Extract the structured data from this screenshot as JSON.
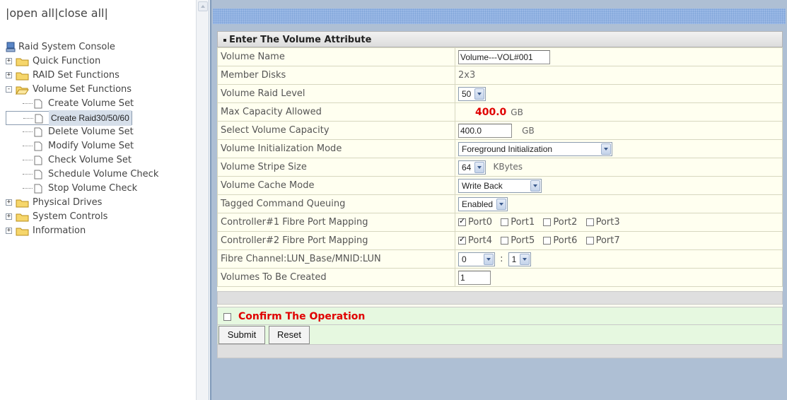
{
  "left": {
    "open_all": "open all",
    "close_all": "close all",
    "root_label": "Raid System Console",
    "items": [
      {
        "label": "Quick Function",
        "expander": "+"
      },
      {
        "label": "RAID Set Functions",
        "expander": "+"
      },
      {
        "label": "Volume Set Functions",
        "expander": "-"
      }
    ],
    "sub_items": [
      {
        "label": "Create Volume Set"
      },
      {
        "label": "Create Raid30/50/60"
      },
      {
        "label": "Delete Volume Set"
      },
      {
        "label": "Modify Volume Set"
      },
      {
        "label": "Check Volume Set"
      },
      {
        "label": "Schedule Volume Check"
      },
      {
        "label": "Stop Volume Check"
      }
    ],
    "bottom_items": [
      {
        "label": "Physical Drives",
        "expander": "+"
      },
      {
        "label": "System Controls",
        "expander": "+"
      },
      {
        "label": "Information",
        "expander": "+"
      }
    ]
  },
  "form": {
    "header": "Enter The Volume Attribute",
    "rows": {
      "volume_name": {
        "label": "Volume Name",
        "value": "Volume---VOL#001"
      },
      "member_disks": {
        "label": "Member Disks",
        "value": "2x3"
      },
      "raid_level": {
        "label": "Volume Raid Level",
        "value": "50"
      },
      "max_capacity": {
        "label": "Max Capacity Allowed",
        "value": "400.0",
        "unit": "GB"
      },
      "select_capacity": {
        "label": "Select Volume Capacity",
        "value": "400.0",
        "unit": "GB"
      },
      "init_mode": {
        "label": "Volume Initialization Mode",
        "value": "Foreground Initialization"
      },
      "stripe_size": {
        "label": "Volume Stripe Size",
        "value": "64",
        "unit": "KBytes"
      },
      "cache_mode": {
        "label": "Volume Cache Mode",
        "value": "Write Back"
      },
      "tagged_queuing": {
        "label": "Tagged Command Queuing",
        "value": "Enabled"
      },
      "ctrl1_ports": {
        "label": "Controller#1 Fibre Port Mapping",
        "ports": [
          {
            "name": "Port0",
            "checked": true
          },
          {
            "name": "Port1",
            "checked": false
          },
          {
            "name": "Port2",
            "checked": false
          },
          {
            "name": "Port3",
            "checked": false
          }
        ]
      },
      "ctrl2_ports": {
        "label": "Controller#2 Fibre Port Mapping",
        "ports": [
          {
            "name": "Port4",
            "checked": true
          },
          {
            "name": "Port5",
            "checked": false
          },
          {
            "name": "Port6",
            "checked": false
          },
          {
            "name": "Port7",
            "checked": false
          }
        ]
      },
      "lun": {
        "label": "Fibre Channel:LUN_Base/MNID:LUN",
        "base": "0",
        "separator": ":",
        "lun": "1"
      },
      "volumes_count": {
        "label": "Volumes To Be Created",
        "value": "1"
      }
    },
    "confirm_label": "Confirm The Operation",
    "submit_label": "Submit",
    "reset_label": "Reset"
  },
  "colors": {
    "accent_red": "#e00000",
    "confirm_bg": "#e6f8e0",
    "form_bg": "#fffff0",
    "frame_blue": "#aebfd4"
  }
}
